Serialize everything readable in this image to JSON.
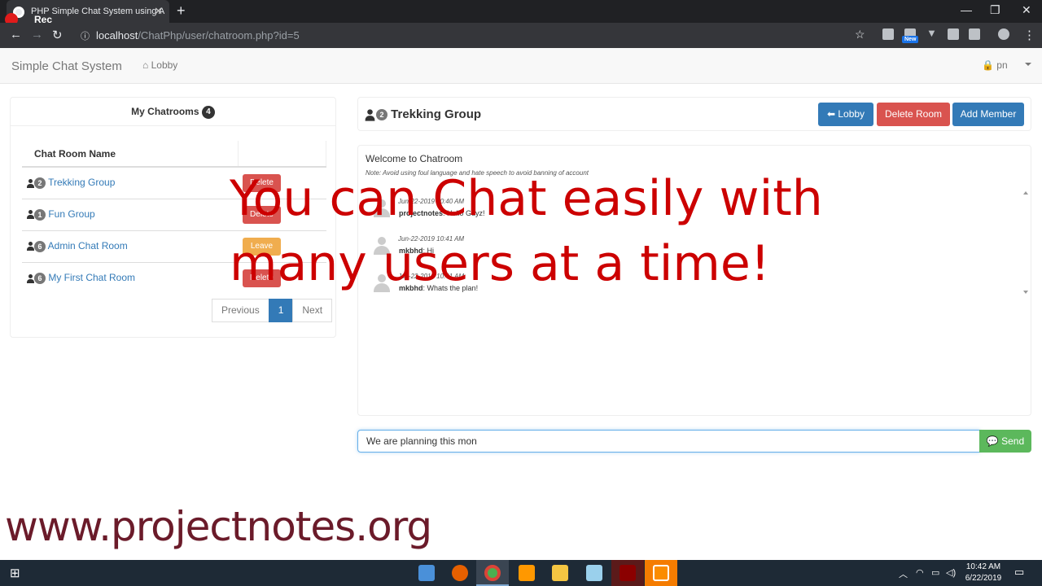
{
  "browser": {
    "tab_title": "PHP Simple Chat System using A",
    "recording_label": "Rec",
    "url_host": "localhost",
    "url_path": "/ChatPhp/user/chatroom.php?id=5",
    "extension_badge": "New"
  },
  "navbar": {
    "brand": "Simple Chat System",
    "lobby_link": "Lobby",
    "user_name": "pn"
  },
  "my_chatrooms": {
    "title": "My Chatrooms",
    "count": "4",
    "column_header": "Chat Room Name",
    "rooms": [
      {
        "members": "2",
        "name": "Trekking Group",
        "action": "Delete"
      },
      {
        "members": "1",
        "name": "Fun Group",
        "action": "Delete"
      },
      {
        "members": "6",
        "name": "Admin Chat Room",
        "action": "Leave"
      },
      {
        "members": "6",
        "name": "My First Chat Room",
        "action": "Delete"
      }
    ],
    "pagination": {
      "previous": "Previous",
      "current": "1",
      "next": "Next"
    }
  },
  "room": {
    "members": "2",
    "name": "Trekking Group",
    "lobby_button": "Lobby",
    "delete_button": "Delete Room",
    "add_member_button": "Add Member",
    "welcome": "Welcome to Chatroom",
    "note": "Note: Avoid using foul language and hate speech to avoid banning of account",
    "messages": [
      {
        "time": "Jun-22-2019 10:40 AM",
        "user": "projectnotes",
        "text": "Hello Guyz!"
      },
      {
        "time": "Jun-22-2019 10:41 AM",
        "user": "mkbhd",
        "text": "Hi"
      },
      {
        "time": "Jun-22-2019 10:41 AM",
        "user": "mkbhd",
        "text": "Whats the plan!"
      }
    ],
    "input_value": "We are planning this mon",
    "send_button": "Send"
  },
  "overlay": {
    "caption": "You can Chat easily with\nmany users at a time!",
    "website": "www.projectnotes.org"
  },
  "taskbar": {
    "time": "10:42 AM",
    "date": "6/22/2019"
  },
  "colors": {
    "primary": "#337ab7",
    "danger": "#d9534f",
    "warning": "#f0ad4e",
    "success": "#5cb85c",
    "overlay_red": "#cc0000",
    "watermark": "#6b1b2a"
  }
}
